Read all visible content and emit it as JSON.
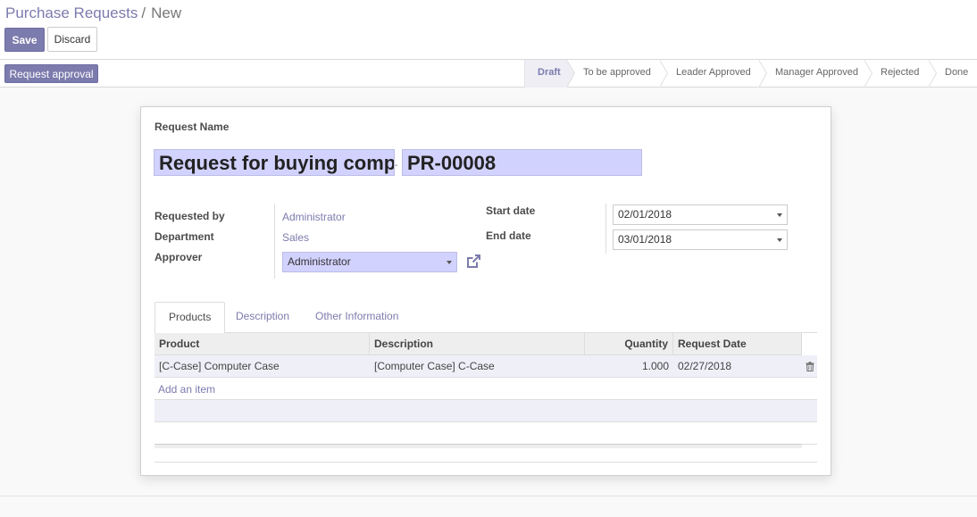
{
  "breadcrumb": {
    "parent": "Purchase Requests",
    "separator": "/",
    "current": "New"
  },
  "buttons": {
    "save": "Save",
    "discard": "Discard",
    "request_approval": "Request approval"
  },
  "stages": [
    "Draft",
    "To be approved",
    "Leader Approved",
    "Manager Approved",
    "Rejected",
    "Done"
  ],
  "active_stage": "Draft",
  "form": {
    "request_name_label": "Request Name",
    "request_name_value": "Request for buying computer case",
    "name_dash": "-",
    "reference": "PR-00008",
    "requested_by_label": "Requested by",
    "requested_by_value": "Administrator",
    "department_label": "Department",
    "department_value": "Sales",
    "approver_label": "Approver",
    "approver_value": "Administrator",
    "start_date_label": "Start date",
    "start_date_value": "02/01/2018",
    "end_date_label": "End date",
    "end_date_value": "03/01/2018"
  },
  "tabs": [
    "Products",
    "Description",
    "Other Information"
  ],
  "table": {
    "headers": [
      "Product",
      "Description",
      "Quantity",
      "Request Date"
    ],
    "rows": [
      {
        "product": "[C-Case] Computer Case",
        "description": "[Computer Case] C-Case",
        "quantity": "1.000",
        "request_date": "02/27/2018"
      }
    ],
    "add_item": "Add an item"
  },
  "icons": {
    "external_link": "external-link-icon",
    "trash": "trash-icon",
    "caret": "caret-down-icon"
  },
  "colors": {
    "primary": "#7c7bad",
    "required_field": "#d2d2ff"
  }
}
